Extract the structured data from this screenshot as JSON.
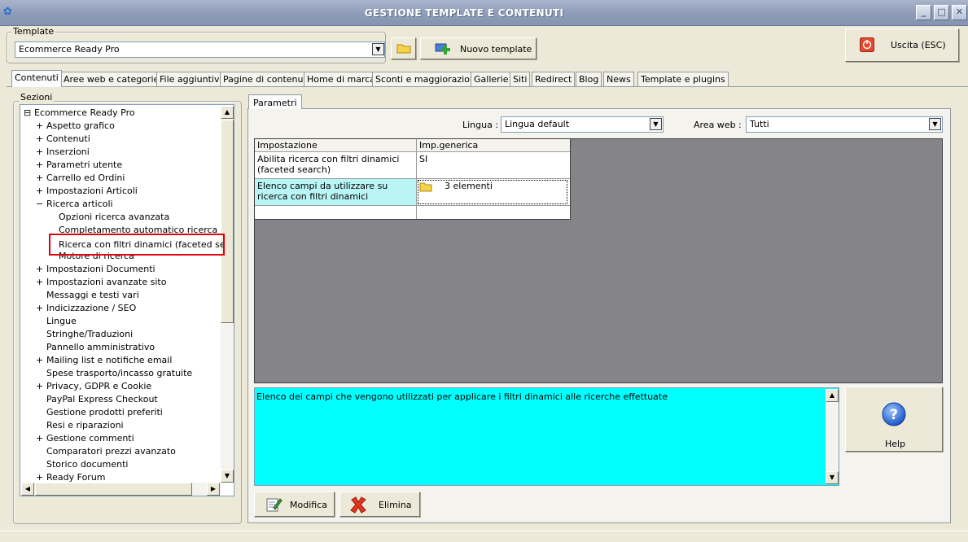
{
  "window": {
    "title": "GESTIONE TEMPLATE E CONTENUTI"
  },
  "template": {
    "group_label": "Template",
    "selected": "Ecommerce Ready Pro",
    "new_button": "Nuovo template"
  },
  "exit_button": "Uscita (ESC)",
  "tabs": [
    {
      "label": "Contenuti"
    },
    {
      "label": "Aree web e categorie"
    },
    {
      "label": "File aggiuntivi"
    },
    {
      "label": "Pagine di contenuti"
    },
    {
      "label": "Home di marca"
    },
    {
      "label": "Sconti e maggiorazioni"
    },
    {
      "label": "Gallerie"
    },
    {
      "label": "Siti"
    },
    {
      "label": "Redirect"
    },
    {
      "label": "Blog"
    },
    {
      "label": "News"
    },
    {
      "label": "Template e plugins"
    }
  ],
  "sections": {
    "label": "Sezioni",
    "tree": [
      {
        "label": "Ecommerce Ready Pro",
        "exp": "⊟"
      },
      {
        "label": "Aspetto grafico",
        "exp": "+"
      },
      {
        "label": "Contenuti",
        "exp": "+"
      },
      {
        "label": "Inserzioni",
        "exp": "+"
      },
      {
        "label": "Parametri utente",
        "exp": "+"
      },
      {
        "label": "Carrello ed Ordini",
        "exp": "+"
      },
      {
        "label": "Impostazioni Articoli",
        "exp": "+"
      },
      {
        "label": "Ricerca articoli",
        "exp": "−"
      },
      {
        "label": "Opzioni ricerca avanzata",
        "exp": ""
      },
      {
        "label": "Completamento automatico ricerca",
        "exp": ""
      },
      {
        "label": "Ricerca con filtri dinamici (faceted search)",
        "exp": ""
      },
      {
        "label": "Motore di ricerca",
        "exp": ""
      },
      {
        "label": "Impostazioni Documenti",
        "exp": "+"
      },
      {
        "label": "Impostazioni avanzate sito",
        "exp": "+"
      },
      {
        "label": "Messaggi e testi vari",
        "exp": ""
      },
      {
        "label": "Indicizzazione / SEO",
        "exp": "+"
      },
      {
        "label": "Lingue",
        "exp": ""
      },
      {
        "label": "Stringhe/Traduzioni",
        "exp": ""
      },
      {
        "label": "Pannello amministrativo",
        "exp": ""
      },
      {
        "label": "Mailing list e notifiche email",
        "exp": "+"
      },
      {
        "label": "Spese trasporto/incasso gratuite",
        "exp": ""
      },
      {
        "label": "Privacy, GDPR e Cookie",
        "exp": "+"
      },
      {
        "label": "PayPal Express Checkout",
        "exp": ""
      },
      {
        "label": "Gestione prodotti preferiti",
        "exp": ""
      },
      {
        "label": "Resi e riparazioni",
        "exp": ""
      },
      {
        "label": "Gestione commenti",
        "exp": "+"
      },
      {
        "label": "Comparatori prezzi avanzato",
        "exp": ""
      },
      {
        "label": "Storico documenti",
        "exp": ""
      },
      {
        "label": "Ready Forum",
        "exp": "+"
      }
    ]
  },
  "params": {
    "tab_label": "Parametri",
    "lingua_label": "Lingua :",
    "lingua_value": "Lingua default",
    "area_label": "Area web :",
    "area_value": "Tutti",
    "columns": [
      "Impostazione",
      "Imp.generica"
    ],
    "rows": [
      {
        "setting": "Abilita ricerca con filtri dinamici (faceted search)",
        "value": "SI"
      },
      {
        "setting": "Elenco campi da utilizzare su ricerca con filtri dinamici",
        "value": "3 elementi"
      }
    ],
    "description": "Elenco dei campi che vengono utilizzati per applicare i filtri dinamici alle ricerche effettuate"
  },
  "buttons": {
    "help": "Help",
    "modifica": "Modifica",
    "elimina": "Elimina"
  },
  "colors": {
    "selected_row": "#b9f5f5",
    "description_bg": "#00ffff",
    "grid_bg": "#858489",
    "highlight_border": "#e0000c"
  }
}
